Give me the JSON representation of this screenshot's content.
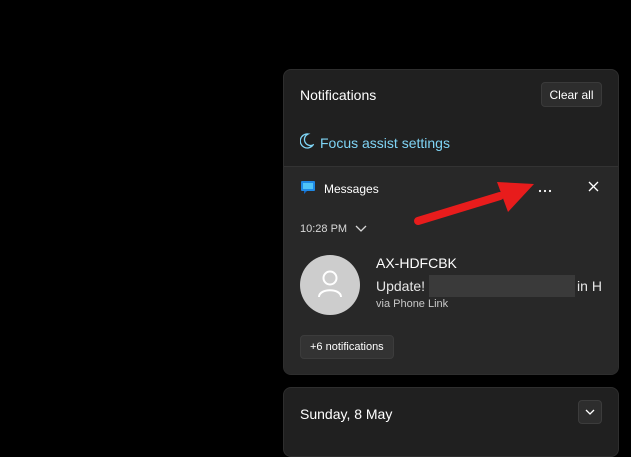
{
  "notifications": {
    "title": "Notifications",
    "clear_all_label": "Clear all",
    "focus_assist_label": "Focus assist settings"
  },
  "message_card": {
    "app_name": "Messages",
    "more_options_icon": "ellipsis-icon",
    "close_icon": "close-icon",
    "time": "10:28 PM",
    "sender": "AX-HDFCBK",
    "body_start": "Update!",
    "body_end": "in H",
    "source": "via Phone Link",
    "more_notifications_label": "+6 notifications"
  },
  "calendar": {
    "date_label": "Sunday, 8 May"
  },
  "colors": {
    "accent": "#7fd4f5",
    "annotation_arrow": "#e81c1c",
    "panel_bg": "#202020",
    "card_bg": "#282828"
  }
}
